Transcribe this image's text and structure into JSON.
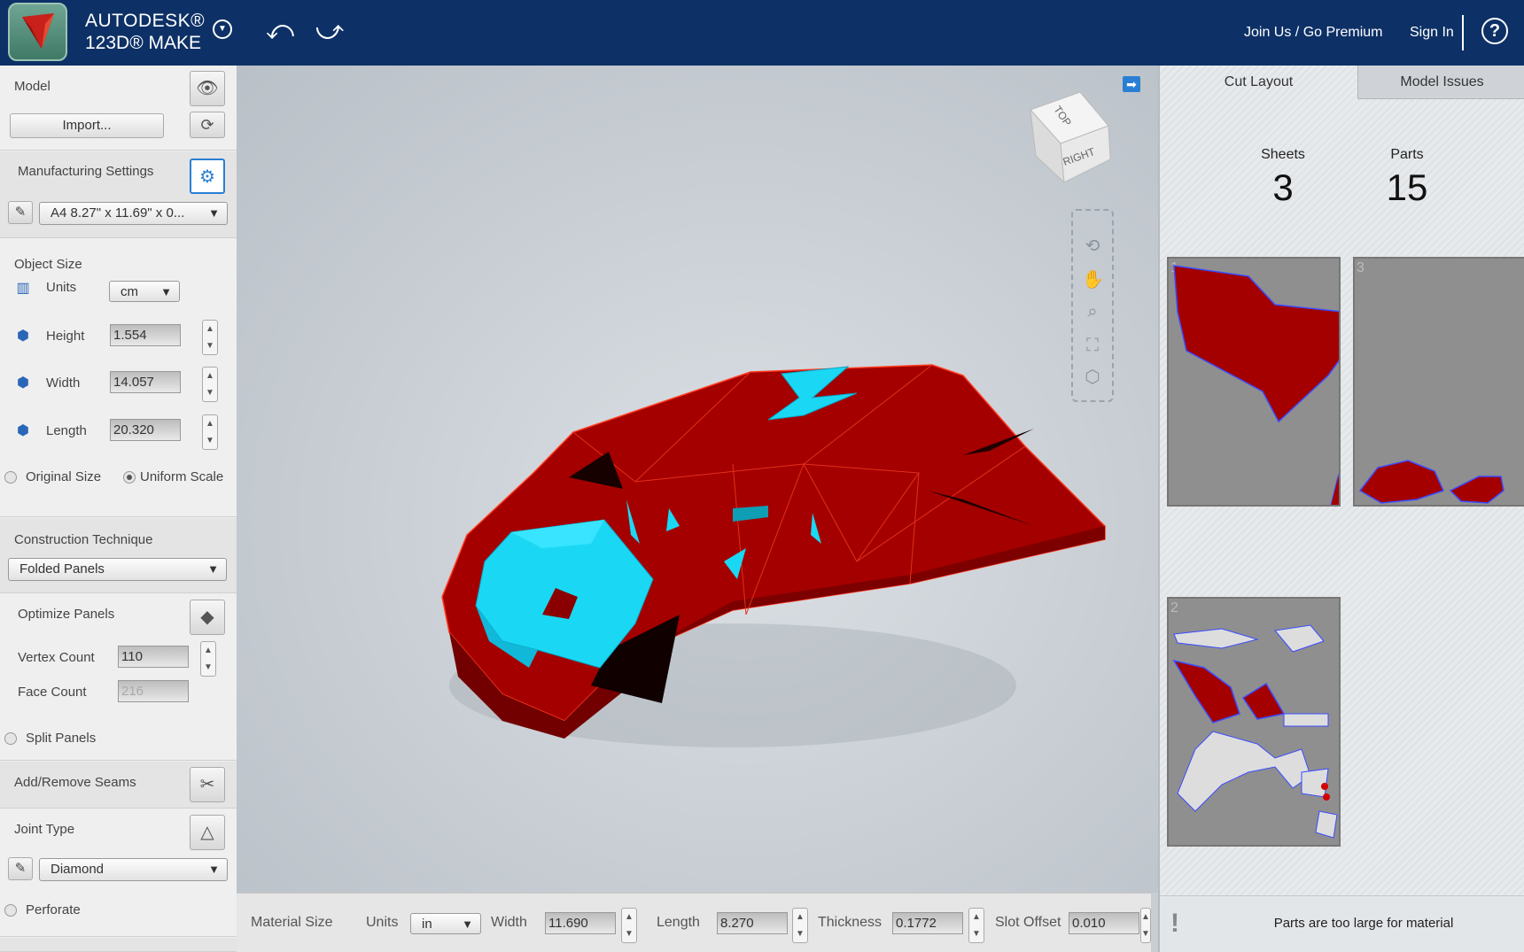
{
  "topbar": {
    "brand_line1": "AUTODESK®",
    "brand_line2": "123D® MAKE",
    "join_label": "Join Us / Go Premium",
    "signin_label": "Sign In",
    "help_label": "?"
  },
  "model": {
    "title": "Model",
    "import_label": "Import..."
  },
  "manufacturing": {
    "title": "Manufacturing Settings",
    "material": "A4 8.27\" x 11.69\" x 0..."
  },
  "object_size": {
    "title": "Object Size",
    "units_label": "Units",
    "units_value": "cm",
    "height_label": "Height",
    "height_value": "1.554",
    "width_label": "Width",
    "width_value": "14.057",
    "length_label": "Length",
    "length_value": "20.320",
    "original_size_label": "Original Size",
    "uniform_scale_label": "Uniform Scale"
  },
  "construction": {
    "title": "Construction Technique",
    "value": "Folded Panels"
  },
  "optimize": {
    "title": "Optimize Panels",
    "vertex_label": "Vertex Count",
    "vertex_value": "110",
    "face_label": "Face Count",
    "face_value": "216",
    "split_label": "Split Panels"
  },
  "seams": {
    "title": "Add/Remove Seams"
  },
  "joint": {
    "title": "Joint Type",
    "value": "Diamond",
    "perforate_label": "Perforate"
  },
  "viewcube": {
    "top_label": "TOP",
    "right_label": "RIGHT"
  },
  "material_bar": {
    "title": "Material Size",
    "units_label": "Units",
    "units_value": "in",
    "width_label": "Width",
    "width_value": "11.690",
    "length_label": "Length",
    "length_value": "8.270",
    "thickness_label": "Thickness",
    "thickness_value": "0.1772",
    "slot_label": "Slot Offset",
    "slot_value": "0.010"
  },
  "right_panel": {
    "tabs": [
      "Cut Layout",
      "Model Issues"
    ],
    "sheets_label": "Sheets",
    "sheets_value": "3",
    "parts_label": "Parts",
    "parts_value": "15",
    "sheet_numbers": [
      "1",
      "3",
      "2"
    ],
    "warning": "Parts are too large for material"
  },
  "colors": {
    "topbar": "#0d3166",
    "model_red": "#a40000",
    "model_cyan": "#1ad8f4",
    "accent_blue": "#2a7fd4"
  }
}
